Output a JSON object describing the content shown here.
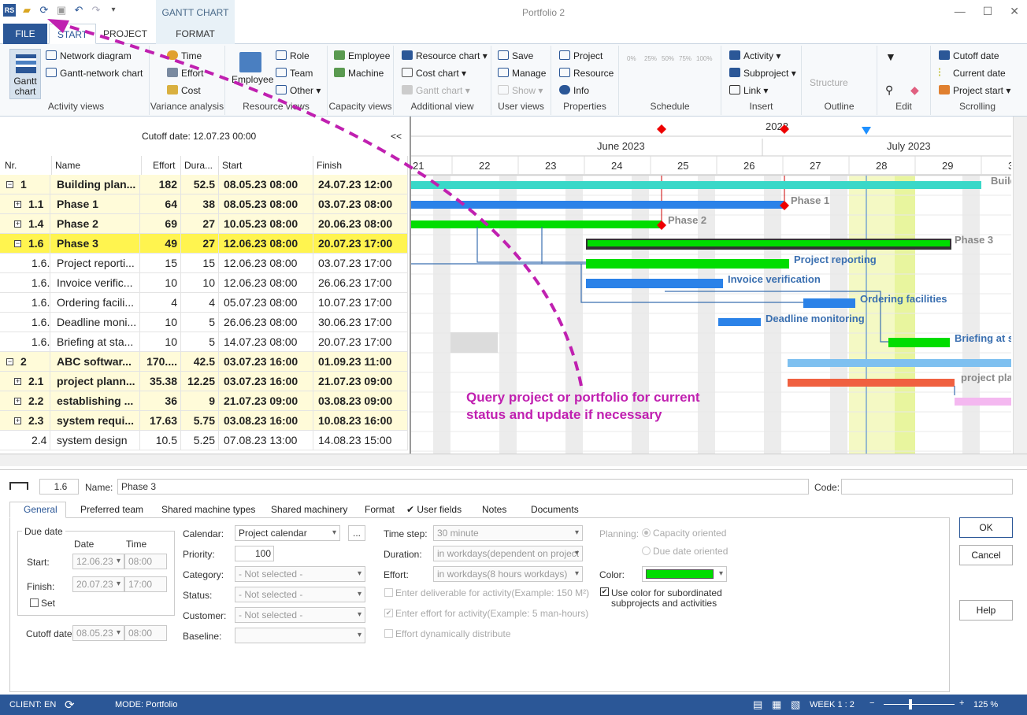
{
  "window": {
    "title": "Portfolio 2",
    "context_group": "GANTT CHART"
  },
  "tabs": [
    {
      "label": "FILE"
    },
    {
      "label": "START"
    },
    {
      "label": "PROJECT"
    },
    {
      "label": "FORMAT"
    }
  ],
  "ribbon": {
    "activity_views": {
      "label": "Activity views",
      "gantt_chart": "Gantt chart",
      "network_diagram": "Network diagram",
      "gantt_network_chart": "Gantt-network chart"
    },
    "variance": {
      "label": "Variance analysis",
      "time": "Time",
      "effort": "Effort",
      "cost": "Cost"
    },
    "resource_views": {
      "label": "Resource views",
      "employee": "Employee",
      "role": "Role",
      "team": "Team",
      "other": "Other"
    },
    "capacity": {
      "label": "Capacity views",
      "employee": "Employee",
      "machine": "Machine"
    },
    "additional": {
      "label": "Additional view",
      "resource_chart": "Resource chart",
      "cost_chart": "Cost chart",
      "gantt_chart": "Gantt chart"
    },
    "user_views": {
      "label": "User views",
      "save": "Save",
      "manage": "Manage",
      "show": "Show"
    },
    "properties": {
      "label": "Properties",
      "project": "Project",
      "resource": "Resource",
      "info": "Info"
    },
    "schedule": {
      "label": "Schedule",
      "pcts": [
        "0%",
        "25%",
        "50%",
        "75%",
        "100%"
      ]
    },
    "insert": {
      "label": "Insert",
      "activity": "Activity",
      "subproject": "Subproject",
      "link": "Link"
    },
    "outline": {
      "label": "Outline",
      "structure": "Structure"
    },
    "edit": {
      "label": "Edit"
    },
    "scrolling": {
      "label": "Scrolling",
      "cutoff_date": "Cutoff date",
      "current_date": "Current date",
      "project_start": "Project start"
    }
  },
  "grid": {
    "cutoff": "Cutoff date: 12.07.23 00:00",
    "collapse": "<<",
    "headers": [
      "Nr.",
      "Name",
      "Effort",
      "Dura...",
      "Start",
      "Finish"
    ],
    "rows": [
      {
        "nr": "1",
        "name": "Building plan...",
        "effort": "182",
        "dur": "52.5",
        "start": "08.05.23 08:00",
        "finish": "24.07.23 12:00",
        "kind": "sum",
        "exp": "−"
      },
      {
        "nr": "1.1",
        "name": "Phase 1",
        "effort": "64",
        "dur": "38",
        "start": "08.05.23 08:00",
        "finish": "03.07.23 08:00",
        "kind": "sum",
        "exp": "+"
      },
      {
        "nr": "1.4",
        "name": "Phase 2",
        "effort": "69",
        "dur": "27",
        "start": "10.05.23 08:00",
        "finish": "20.06.23 08:00",
        "kind": "sum",
        "exp": "+"
      },
      {
        "nr": "1.6",
        "name": "Phase 3",
        "effort": "49",
        "dur": "27",
        "start": "12.06.23 08:00",
        "finish": "20.07.23 17:00",
        "kind": "sel",
        "exp": "−"
      },
      {
        "nr": "1.6.",
        "name": "Project reporti...",
        "effort": "15",
        "dur": "15",
        "start": "12.06.23 08:00",
        "finish": "03.07.23 17:00",
        "kind": "norm",
        "exp": ""
      },
      {
        "nr": "1.6.",
        "name": "Invoice verific...",
        "effort": "10",
        "dur": "10",
        "start": "12.06.23 08:00",
        "finish": "26.06.23 17:00",
        "kind": "norm",
        "exp": ""
      },
      {
        "nr": "1.6.",
        "name": "Ordering facili...",
        "effort": "4",
        "dur": "4",
        "start": "05.07.23 08:00",
        "finish": "10.07.23 17:00",
        "kind": "norm",
        "exp": ""
      },
      {
        "nr": "1.6.",
        "name": "Deadline moni...",
        "effort": "10",
        "dur": "5",
        "start": "26.06.23 08:00",
        "finish": "30.06.23 17:00",
        "kind": "norm",
        "exp": ""
      },
      {
        "nr": "1.6.",
        "name": "Briefing at sta...",
        "effort": "10",
        "dur": "5",
        "start": "14.07.23 08:00",
        "finish": "20.07.23 17:00",
        "kind": "norm",
        "exp": ""
      },
      {
        "nr": "2",
        "name": "ABC softwar...",
        "effort": "170....",
        "dur": "42.5",
        "start": "03.07.23 16:00",
        "finish": "01.09.23 11:00",
        "kind": "sum",
        "exp": "−"
      },
      {
        "nr": "2.1",
        "name": "project plann...",
        "effort": "35.38",
        "dur": "12.25",
        "start": "03.07.23 16:00",
        "finish": "21.07.23 09:00",
        "kind": "sum",
        "exp": "+"
      },
      {
        "nr": "2.2",
        "name": "establishing ...",
        "effort": "36",
        "dur": "9",
        "start": "21.07.23 09:00",
        "finish": "03.08.23 09:00",
        "kind": "sum",
        "exp": "+"
      },
      {
        "nr": "2.3",
        "name": "system requi...",
        "effort": "17.63",
        "dur": "5.75",
        "start": "03.08.23 16:00",
        "finish": "10.08.23 16:00",
        "kind": "sum",
        "exp": "+"
      },
      {
        "nr": "2.4",
        "name": "system design",
        "effort": "10.5",
        "dur": "5.25",
        "start": "07.08.23 13:00",
        "finish": "14.08.23 15:00",
        "kind": "norm",
        "exp": ""
      }
    ]
  },
  "gantt": {
    "year": "2023",
    "month1": "June 2023",
    "month2": "July 2023",
    "weeks": [
      "21",
      "22",
      "23",
      "24",
      "25",
      "26",
      "27",
      "28",
      "29",
      "3"
    ],
    "labels": {
      "b1": "Build",
      "p1": "Phase 1",
      "p2": "Phase 2",
      "p3": "Phase 3",
      "pr": "Project reporting",
      "iv": "Invoice verification",
      "of": "Ordering facilities",
      "dm": "Deadline monitoring",
      "bs": "Briefing at s",
      "pp": "project pla"
    }
  },
  "annotation": {
    "line1": "Query project or portfolio for current",
    "line2": "status and update if necessary"
  },
  "detail": {
    "nr": "1.6",
    "name_label": "Name:",
    "name": "Phase 3",
    "code_label": "Code:",
    "tabs": [
      "General",
      "Preferred team",
      "Shared machine types",
      "Shared machinery",
      "Format",
      "✔ User fields",
      "Notes",
      "Documents"
    ],
    "due": {
      "title": "Due date",
      "date_h": "Date",
      "time_h": "Time",
      "start_l": "Start:",
      "start_d": "12.06.23",
      "start_t": "08:00",
      "finish_l": "Finish:",
      "finish_d": "20.07.23",
      "finish_t": "17:00",
      "set": "Set"
    },
    "cutoff_l": "Cutoff date:",
    "cutoff_d": "08.05.23",
    "cutoff_t": "08:00",
    "calendar_l": "Calendar:",
    "calendar": "Project calendar",
    "more": "...",
    "priority_l": "Priority:",
    "priority": "100",
    "category_l": "Category:",
    "category": "- Not selected -",
    "status_l": "Status:",
    "status": "- Not selected -",
    "customer_l": "Customer:",
    "customer": "- Not selected -",
    "baseline_l": "Baseline:",
    "timestep_l": "Time step:",
    "timestep": "30 minute",
    "duration_l": "Duration:",
    "duration": "in workdays(dependent on project c",
    "effort_l": "Effort:",
    "effort": "in workdays(8 hours workdays)",
    "deliv": "Enter deliverable for activity(Example: 150 M²)",
    "enteff": "Enter effort for activity(Example: 5 man-hours)",
    "dyn": "Effort dynamically distribute",
    "planning_l": "Planning:",
    "cap": "Capacity oriented",
    "due_o": "Due date oriented",
    "color_l": "Color:",
    "color": "#00dd00",
    "usecolor1": "Use color for subordinated",
    "usecolor2": "subprojects and activities",
    "ok": "OK",
    "cancel": "Cancel",
    "help": "Help"
  },
  "statusbar": {
    "client": "CLIENT: EN",
    "mode": "MODE: Portfolio",
    "week": "WEEK 1 : 2",
    "zoom": "125 %"
  }
}
